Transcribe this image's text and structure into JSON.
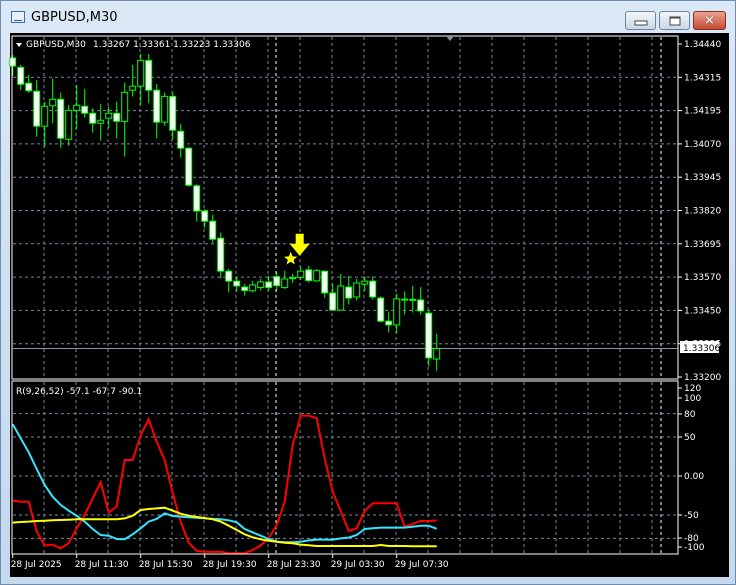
{
  "window": {
    "title": "GBPUSD,M30",
    "buttons": {
      "minimize": "minimize",
      "maximize": "maximize",
      "close": "✕"
    }
  },
  "chart_header": {
    "symbol": "GBPUSD,M30",
    "ohlc": "1.33267 1.33361 1.33223 1.33306"
  },
  "indicator_header": "R(9,26,52) -57.1 -67.7 -90.1",
  "current_price_label": "1.33306",
  "colors": {
    "background": "#000000",
    "candle_outline": "#00ff00",
    "bear_body": "#ffffff",
    "bull_body": "#000000",
    "grid": "#7a8799",
    "line_red": "#ff0000",
    "line_cyan": "#33e6ff",
    "line_yellow": "#ffff00",
    "marker": "#ffff00"
  },
  "icons": {
    "dropdown": "triangle-down-icon",
    "signal_arrow": "arrow-down-icon",
    "signal_star": "star-icon"
  },
  "chart_data": [
    {
      "type": "candlestick",
      "title": "GBPUSD,M30",
      "grid": true,
      "ylim": [
        1.332,
        1.3444
      ],
      "y_ticks": [
        "1.34440",
        "1.34315",
        "1.34195",
        "1.34070",
        "1.33945",
        "1.33820",
        "1.33695",
        "1.33570",
        "1.33450",
        "1.33325",
        "1.33200"
      ],
      "x_ticks": [
        {
          "bar": 0,
          "label": "28 Jul 2025"
        },
        {
          "bar": 8,
          "label": "28 Jul 11:30"
        },
        {
          "bar": 16,
          "label": "28 Jul 15:30"
        },
        {
          "bar": 24,
          "label": "28 Jul 19:30"
        },
        {
          "bar": 32,
          "label": "28 Jul 23:30"
        },
        {
          "bar": 40,
          "label": "29 Jul 03:30"
        },
        {
          "bar": 48,
          "label": "29 Jul 07:30"
        }
      ],
      "period_separator_bars": [
        33
      ],
      "current_price": 1.33306,
      "markers": [
        {
          "bar": 36,
          "type": "arrow-down",
          "price": 1.33685
        },
        {
          "bar": 35,
          "type": "star",
          "price": 1.3364
        }
      ],
      "candles": [
        [
          1.34388,
          1.34399,
          1.34321,
          1.34358
        ],
        [
          1.34353,
          1.34362,
          1.34269,
          1.3429
        ],
        [
          1.34294,
          1.34325,
          1.34258,
          1.34266
        ],
        [
          1.34264,
          1.34306,
          1.34095,
          1.34134
        ],
        [
          1.34134,
          1.34225,
          1.34058,
          1.34208
        ],
        [
          1.3421,
          1.34312,
          1.34145,
          1.34234
        ],
        [
          1.34234,
          1.34259,
          1.34054,
          1.34089
        ],
        [
          1.34085,
          1.34213,
          1.34062,
          1.34193
        ],
        [
          1.34193,
          1.34287,
          1.34124,
          1.34212
        ],
        [
          1.34208,
          1.34273,
          1.34166,
          1.34182
        ],
        [
          1.34182,
          1.34201,
          1.3411,
          1.34145
        ],
        [
          1.34145,
          1.34217,
          1.3408,
          1.34156
        ],
        [
          1.34164,
          1.34207,
          1.34126,
          1.34182
        ],
        [
          1.34182,
          1.34225,
          1.34088,
          1.34152
        ],
        [
          1.34152,
          1.34296,
          1.34021,
          1.3426
        ],
        [
          1.34268,
          1.34362,
          1.34244,
          1.34283
        ],
        [
          1.34283,
          1.34403,
          1.34213,
          1.34379
        ],
        [
          1.34379,
          1.34403,
          1.34219,
          1.34268
        ],
        [
          1.34268,
          1.34291,
          1.34088,
          1.34149
        ],
        [
          1.34149,
          1.34259,
          1.34135,
          1.34245
        ],
        [
          1.34245,
          1.34259,
          1.34083,
          1.34119
        ],
        [
          1.34115,
          1.34142,
          1.34017,
          1.34052
        ],
        [
          1.34052,
          1.34056,
          1.33909,
          1.33914
        ],
        [
          1.33912,
          1.33918,
          1.33779,
          1.33818
        ],
        [
          1.33818,
          1.33826,
          1.33754,
          1.3378
        ],
        [
          1.3378,
          1.33804,
          1.33699,
          1.33713
        ],
        [
          1.33717,
          1.33738,
          1.33567,
          1.33594
        ],
        [
          1.33594,
          1.33603,
          1.33515,
          1.33557
        ],
        [
          1.33557,
          1.33574,
          1.33519,
          1.33539
        ],
        [
          1.33535,
          1.33546,
          1.33503,
          1.33522
        ],
        [
          1.33521,
          1.33558,
          1.33515,
          1.33543
        ],
        [
          1.33533,
          1.33565,
          1.33522,
          1.33554
        ],
        [
          1.33554,
          1.33577,
          1.33522,
          1.33533
        ],
        [
          1.33574,
          1.33593,
          1.33522,
          1.3354
        ],
        [
          1.33533,
          1.33596,
          1.33527,
          1.33565
        ],
        [
          1.3357,
          1.33584,
          1.3355,
          1.33568
        ],
        [
          1.33571,
          1.33612,
          1.33562,
          1.33594
        ],
        [
          1.33599,
          1.33614,
          1.33552,
          1.33559
        ],
        [
          1.33558,
          1.33602,
          1.33554,
          1.33596
        ],
        [
          1.33594,
          1.33596,
          1.33495,
          1.33513
        ],
        [
          1.33513,
          1.33547,
          1.33448,
          1.33449
        ],
        [
          1.33449,
          1.33584,
          1.33447,
          1.33539
        ],
        [
          1.33535,
          1.33577,
          1.3347,
          1.33494
        ],
        [
          1.33498,
          1.33565,
          1.33485,
          1.3355
        ],
        [
          1.33546,
          1.33574,
          1.33522,
          1.33557
        ],
        [
          1.33557,
          1.33574,
          1.33488,
          1.33498
        ],
        [
          1.33494,
          1.335,
          1.33403,
          1.33408
        ],
        [
          1.33408,
          1.33443,
          1.33366,
          1.33394
        ],
        [
          1.33394,
          1.3351,
          1.33364,
          1.33491
        ],
        [
          1.33489,
          1.33519,
          1.33433,
          1.3349
        ],
        [
          1.33488,
          1.3354,
          1.3344,
          1.33489
        ],
        [
          1.33487,
          1.33535,
          1.33432,
          1.33446
        ],
        [
          1.33438,
          1.33448,
          1.3324,
          1.33271
        ],
        [
          1.33267,
          1.33361,
          1.33223,
          1.33306
        ]
      ]
    },
    {
      "type": "line",
      "title": "R(9,26,52)",
      "grid": true,
      "ylim": [
        -100,
        120
      ],
      "y_ticks": [
        "120",
        "100",
        "80",
        "50",
        "0.00",
        "-50",
        "-80",
        "-100"
      ],
      "grid_levels": [
        80,
        50,
        0,
        -50,
        -80
      ],
      "series": [
        {
          "color": "#ff0000",
          "values": [
            -31.6,
            -33,
            -33,
            -71,
            -89,
            -88,
            -92.7,
            -86,
            -67,
            -50,
            -28.6,
            -8,
            -47,
            -39,
            20.5,
            20.5,
            52.6,
            72.7,
            44,
            20.5,
            -22,
            -58.6,
            -85.5,
            -96,
            -97,
            -97,
            -97,
            -99,
            -99,
            -99,
            -95,
            -89,
            -80,
            -63,
            -33,
            39.7,
            77.4,
            77.4,
            74,
            22.6,
            -20,
            -45,
            -70.5,
            -67,
            -45,
            -35,
            -35,
            -35,
            -35,
            -65,
            -61.5,
            -57.7,
            -57.7,
            -57.1
          ]
        },
        {
          "color": "#33e6ff",
          "values": [
            66.3,
            48.3,
            30.3,
            9,
            -11.5,
            -26.5,
            -37,
            -44.5,
            -51,
            -58.5,
            -68,
            -75.6,
            -76.5,
            -80.8,
            -81,
            -74.8,
            -67,
            -58.5,
            -55,
            -47.9,
            -51.3,
            -52,
            -53,
            -53.5,
            -54.3,
            -55,
            -55.5,
            -56.8,
            -59.4,
            -68,
            -72.3,
            -76.5,
            -80.8,
            -84.2,
            -85,
            -85,
            -84.2,
            -82.5,
            -81.6,
            -81.6,
            -81.6,
            -80,
            -79,
            -75.6,
            -68,
            -67,
            -66.2,
            -66.2,
            -66.2,
            -66.2,
            -65,
            -63.7,
            -63.7,
            -67.7
          ]
        },
        {
          "color": "#ffff00",
          "values": [
            -59.8,
            -59,
            -58.5,
            -57.7,
            -57.3,
            -56.8,
            -56.4,
            -56,
            -55.5,
            -55.5,
            -55.5,
            -55.5,
            -55.5,
            -55.5,
            -54.3,
            -50.9,
            -43.6,
            -42.3,
            -41.5,
            -40.6,
            -44.5,
            -48.3,
            -50.9,
            -52.6,
            -53.8,
            -55.5,
            -58.5,
            -63.7,
            -69.2,
            -74.8,
            -78.6,
            -81.2,
            -82.9,
            -84.2,
            -85.5,
            -86.3,
            -88,
            -88.9,
            -89.7,
            -89.7,
            -89.7,
            -89.7,
            -89.7,
            -89.7,
            -89.7,
            -89.7,
            -88.5,
            -89.7,
            -89.7,
            -89.7,
            -90,
            -90.1,
            -90.1,
            -90.1
          ]
        }
      ]
    }
  ]
}
